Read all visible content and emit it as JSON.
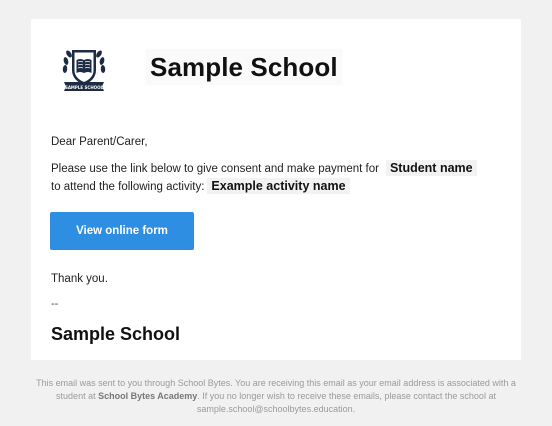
{
  "header": {
    "school_name": "Sample School",
    "crest_banner_text": "SAMPLE SCHOOL"
  },
  "body": {
    "greeting": "Dear Parent/Carer,",
    "para_line1": "Please use the link below to give consent and make payment for",
    "student_name": "Student name",
    "para_line2": "to attend the following activity:",
    "activity_name": "Example activity name",
    "button_label": "View online form",
    "thanks": "Thank you.",
    "dashes": "--",
    "signature": "Sample School"
  },
  "footer": {
    "text1": "This email was sent to you through School Bytes. You are receiving this email as your email address is associated with a student at ",
    "academy": "School Bytes Academy",
    "text2": ". If you no longer wish to receive these emails, please contact the school at sample.school@schoolbytes.education."
  },
  "colors": {
    "button": "#2e8fe2",
    "background": "#f1f1f1",
    "card": "#ffffff"
  }
}
